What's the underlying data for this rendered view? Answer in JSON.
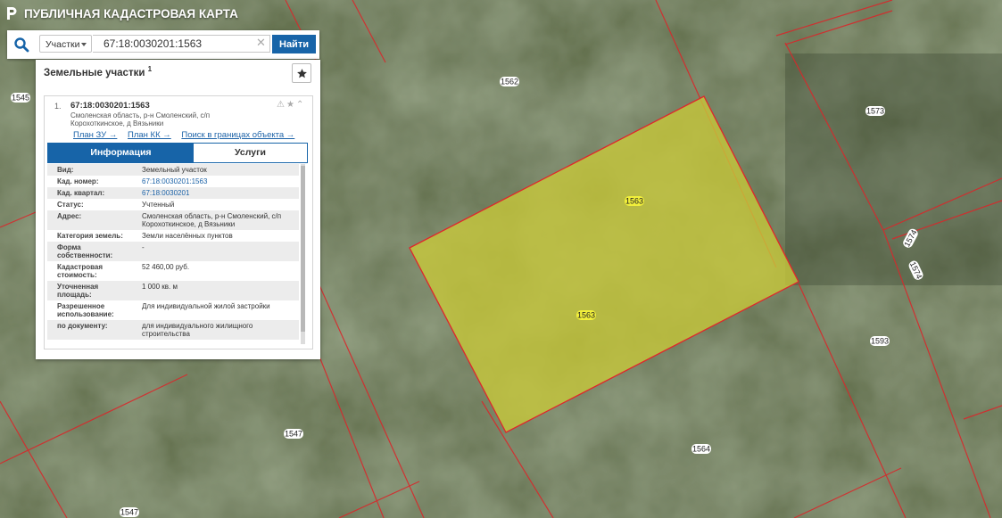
{
  "app": {
    "title": "ПУБЛИЧНАЯ КАДАСТРОВАЯ КАРТА"
  },
  "search": {
    "type_label": "Участки",
    "query": "67:18:0030201:1563",
    "find_label": "Найти"
  },
  "panel": {
    "title": "Земельные участки",
    "count": "1",
    "result": {
      "index": "1.",
      "cad_number": "67:18:0030201:1563",
      "address_line1": "Смоленская область, р-н Смоленский, с/п",
      "address_line2": "Корохоткинское, д Вязьники",
      "links": {
        "plan_zu": "План ЗУ →",
        "plan_kk": "План КК →",
        "search_bounds": "Поиск в границах объекта →"
      }
    },
    "tabs": {
      "info": "Информация",
      "services": "Услуги"
    },
    "attributes": [
      {
        "label": "Вид:",
        "value": "Земельный участок"
      },
      {
        "label": "Кад. номер:",
        "value": "67:18:0030201:1563"
      },
      {
        "label": "Кад. квартал:",
        "value": "67:18:0030201"
      },
      {
        "label": "Статус:",
        "value": "Учтенный"
      },
      {
        "label": "Адрес:",
        "value": "Смоленская область, р-н Смоленский, с/п Корохоткинское, д Вязьники"
      },
      {
        "label": "Категория земель:",
        "value": "Земли населённых пунктов"
      },
      {
        "label": "Форма собственности:",
        "value": "-"
      },
      {
        "label": "Кадастровая стоимость:",
        "value": "52 460,00 руб."
      },
      {
        "label": "Уточненная площадь:",
        "value": "1 000 кв. м"
      },
      {
        "label": "Разрешенное использование:",
        "value": "Для индивидуальной жилой застройки"
      },
      {
        "label": "по документу:",
        "value": "для индивидуального жилищного строительства"
      }
    ]
  },
  "map": {
    "parcel_labels": {
      "p1545": "1545",
      "p1562": "1562",
      "p1573": "1573",
      "p1563a": "1563",
      "p1563b": "1563",
      "p1574a": "1574",
      "p1574b": "1574",
      "p1593": "1593",
      "p1547a": "1547",
      "p1564": "1564",
      "p1547b": "1547"
    },
    "colors": {
      "boundary": "#e0262b",
      "selected_fill": "#c9c93a",
      "label_selected": "#f1ef3b"
    }
  }
}
